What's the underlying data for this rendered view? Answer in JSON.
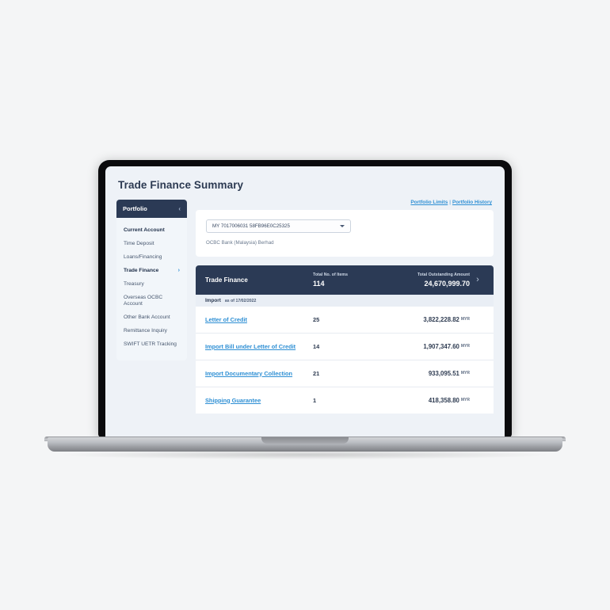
{
  "page": {
    "title": "Trade Finance Summary"
  },
  "sidebar": {
    "header": "Portfolio",
    "collapse_icon": "chevron-left",
    "items": [
      {
        "label": "Current Account",
        "bold": true,
        "chevron": ""
      },
      {
        "label": "Time Deposit",
        "bold": false,
        "chevron": ""
      },
      {
        "label": "Loans/Financing",
        "bold": false,
        "chevron": ""
      },
      {
        "label": "Trade Finance",
        "bold": true,
        "chevron": "›"
      },
      {
        "label": "Treasury",
        "bold": false,
        "chevron": ""
      },
      {
        "label": "Overseas OCBC Account",
        "bold": false,
        "chevron": ""
      },
      {
        "label": "Other Bank Account",
        "bold": false,
        "chevron": ""
      },
      {
        "label": "Remittance Inquiry",
        "bold": false,
        "chevron": ""
      },
      {
        "label": "SWIFT UETR Tracking",
        "bold": false,
        "chevron": ""
      }
    ]
  },
  "toplinks": {
    "portfolio_limits": "Portfolio Limits",
    "separator": "|",
    "portfolio_history": "Portfolio History"
  },
  "account": {
    "selected": "MY 7017006031 58FB96E0C25325",
    "bank_name": "OCBC Bank (Malaysia) Berhad",
    "dropdown_icon": "chevron-down"
  },
  "summary": {
    "title": "Trade Finance",
    "items_label": "Total No. of Items",
    "items_value": "114",
    "amount_label": "Total Outstanding Amount",
    "amount_value": "24,670,999.70",
    "arrow_icon": "chevron-right",
    "section": {
      "title": "Import",
      "as_of": "as of 17/02/2022"
    },
    "rows": [
      {
        "name": "Letter of Credit",
        "items": "25",
        "amount": "3,822,228.82",
        "currency": "MYR"
      },
      {
        "name": "Import Bill under Letter of Credit",
        "items": "14",
        "amount": "1,907,347.60",
        "currency": "MYR"
      },
      {
        "name": "Import Documentary Collection",
        "items": "21",
        "amount": "933,095.51",
        "currency": "MYR"
      },
      {
        "name": "Shipping Guarantee",
        "items": "1",
        "amount": "418,358.80",
        "currency": "MYR"
      }
    ]
  },
  "colors": {
    "navy": "#2b3a55",
    "link_blue": "#2e8fd4",
    "page_bg": "#eef2f7",
    "band": "#e9eef5"
  }
}
